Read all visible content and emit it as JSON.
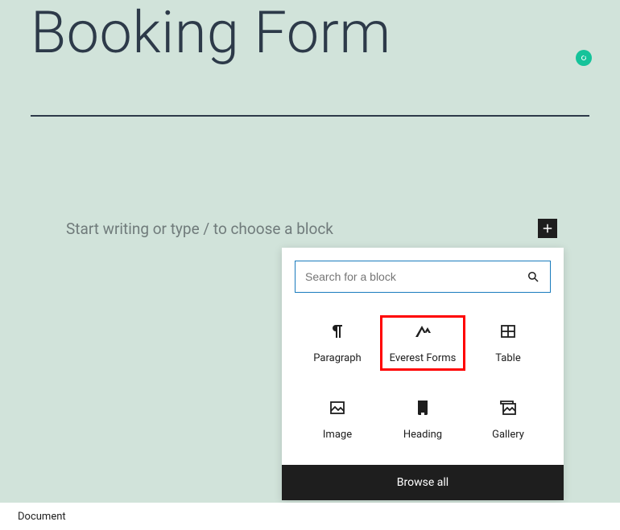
{
  "title": "Booking Form",
  "prompt": "Start writing or type / to choose a block",
  "search": {
    "placeholder": "Search for a block"
  },
  "blocks": {
    "paragraph": "Paragraph",
    "everest": "Everest Forms",
    "table": "Table",
    "image": "Image",
    "heading": "Heading",
    "gallery": "Gallery"
  },
  "browse": "Browse all",
  "footer": "Document"
}
